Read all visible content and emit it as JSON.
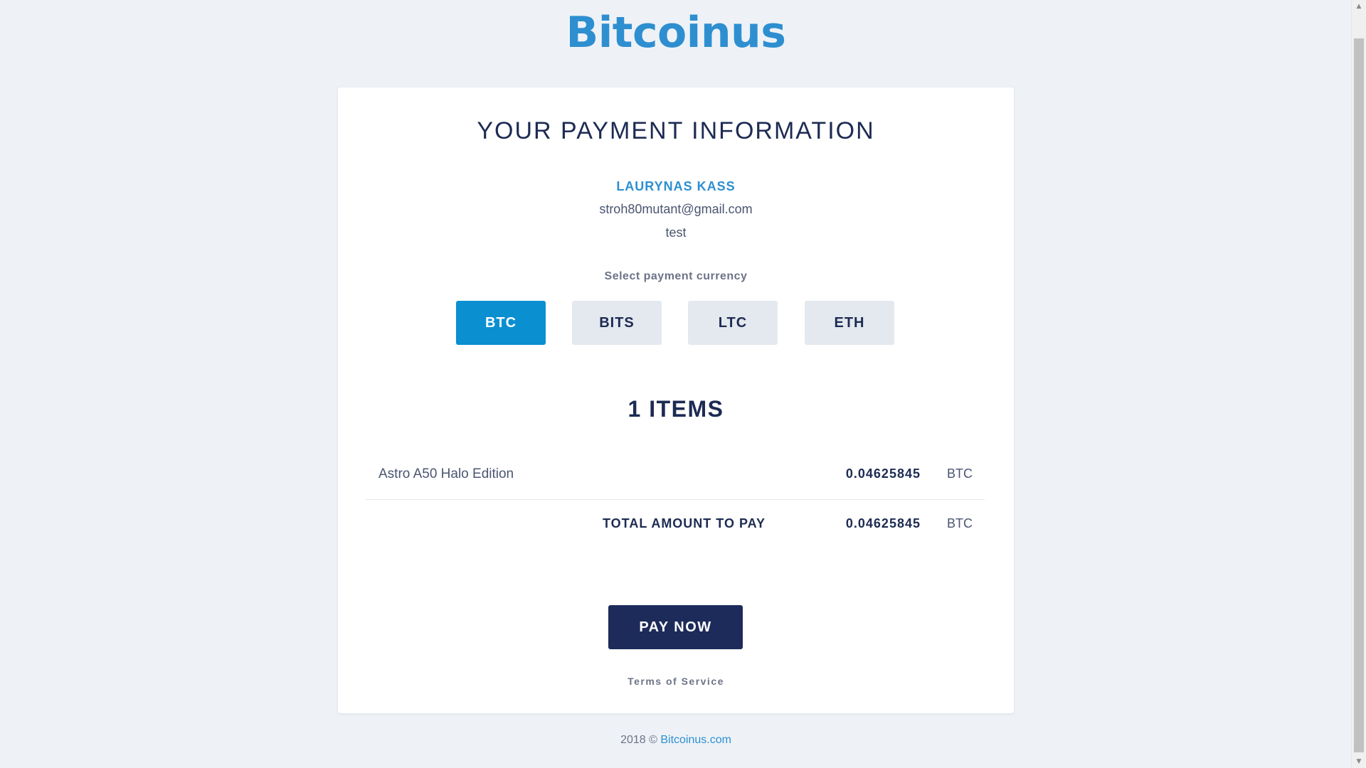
{
  "brand": {
    "logo_text": "Bitcoinus"
  },
  "card": {
    "title": "YOUR PAYMENT INFORMATION",
    "customer": {
      "name": "LAURYNAS KASS",
      "email": "stroh80mutant@gmail.com",
      "note": "test"
    },
    "currency_label": "Select payment currency",
    "currencies": [
      {
        "label": "BTC",
        "selected": true
      },
      {
        "label": "BITS",
        "selected": false
      },
      {
        "label": "LTC",
        "selected": false
      },
      {
        "label": "ETH",
        "selected": false
      }
    ],
    "items_title": "1 ITEMS",
    "items": [
      {
        "name": "Astro A50 Halo Edition",
        "amount": "0.04625845",
        "unit": "BTC"
      }
    ],
    "total": {
      "label": "TOTAL AMOUNT TO PAY",
      "amount": "0.04625845",
      "unit": "BTC"
    },
    "pay_button": "PAY NOW",
    "terms_link": "Terms of Service"
  },
  "footer": {
    "copyright": "2018 ©",
    "link_text": "Bitcoinus.com"
  },
  "colors": {
    "background": "#eef2f6",
    "brand_blue": "#2e8fd0",
    "active_currency": "#0a8fd1",
    "pay_button": "#1c2b5a",
    "text_dark": "#1d2b53"
  }
}
